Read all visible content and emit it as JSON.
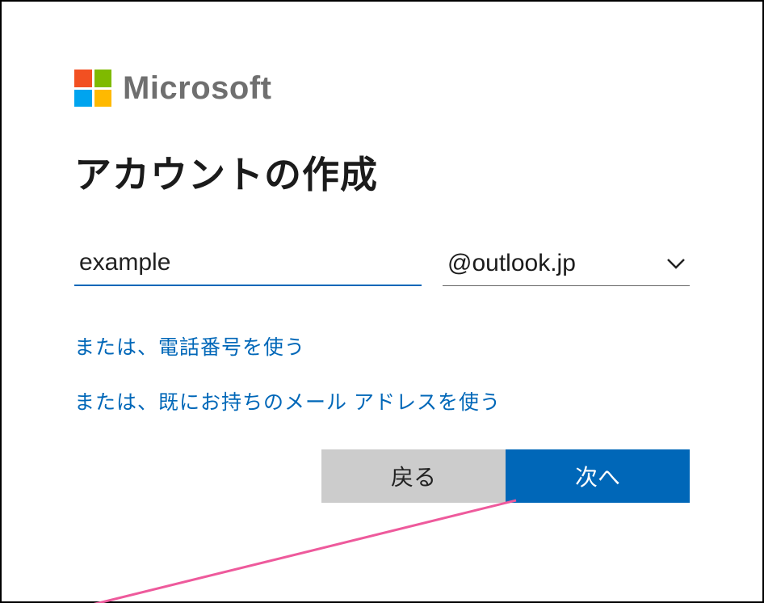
{
  "brand": {
    "name": "Microsoft"
  },
  "heading": "アカウントの作成",
  "email": {
    "value": "example"
  },
  "domain": {
    "selected": "@outlook.jp"
  },
  "links": {
    "use_phone": "または、電話番号を使う",
    "use_existing_email": "または、既にお持ちのメール アドレスを使う"
  },
  "buttons": {
    "back": "戻る",
    "next": "次へ"
  },
  "colors": {
    "primary": "#0067b8",
    "link": "#0067b8"
  }
}
